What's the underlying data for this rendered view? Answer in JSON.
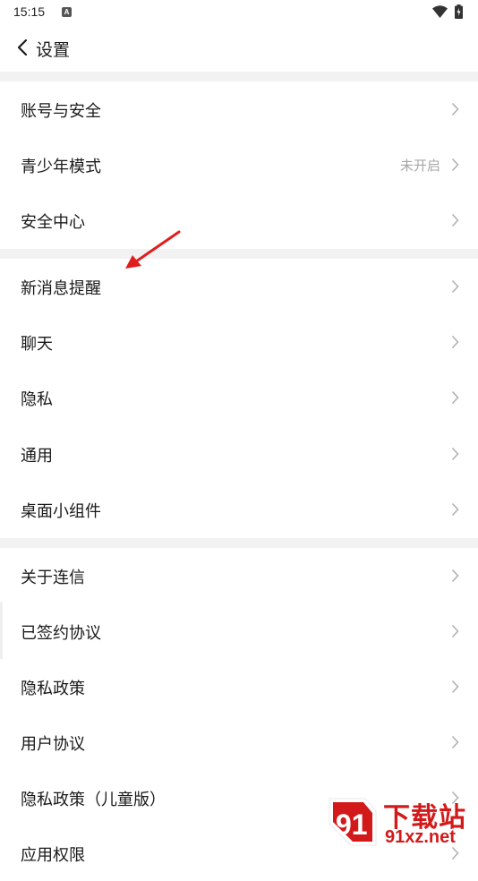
{
  "status_bar": {
    "time": "15:15",
    "notification_icon": "A"
  },
  "header": {
    "back_icon": "chevron-left-icon",
    "title": "设置"
  },
  "sections": [
    {
      "items": [
        {
          "label": "账号与安全",
          "value": ""
        },
        {
          "label": "青少年模式",
          "value": "未开启"
        },
        {
          "label": "安全中心",
          "value": ""
        }
      ]
    },
    {
      "items": [
        {
          "label": "新消息提醒",
          "value": ""
        },
        {
          "label": "聊天",
          "value": ""
        },
        {
          "label": "隐私",
          "value": ""
        },
        {
          "label": "通用",
          "value": ""
        },
        {
          "label": "桌面小组件",
          "value": ""
        }
      ]
    },
    {
      "items": [
        {
          "label": "关于连信",
          "value": ""
        },
        {
          "label": "已签约协议",
          "value": ""
        },
        {
          "label": "隐私政策",
          "value": ""
        },
        {
          "label": "用户协议",
          "value": ""
        },
        {
          "label": "隐私政策（儿童版）",
          "value": ""
        },
        {
          "label": "应用权限",
          "value": ""
        }
      ]
    }
  ],
  "watermark": {
    "top": "下载站",
    "bottom": "91xz.net",
    "logo": "91"
  },
  "colors": {
    "divider": "#f2f2f2",
    "chevron": "#b3b3b3",
    "value_text": "#a6a6a6",
    "annotation_arrow": "#e01e1e",
    "watermark": "#d31a1a"
  }
}
